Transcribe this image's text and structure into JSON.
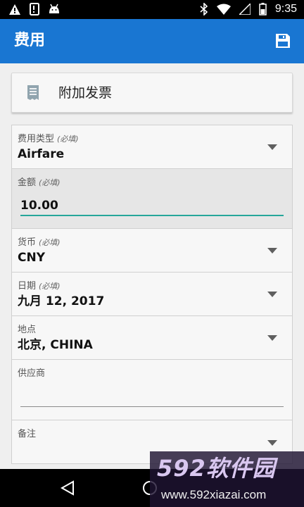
{
  "status_bar": {
    "time": "9:35",
    "left_icons": [
      "warning-icon",
      "sim-card-icon",
      "android-icon"
    ],
    "right_icons": [
      "bluetooth-icon",
      "wifi-icon",
      "signal-icon",
      "battery-icon"
    ]
  },
  "app_bar": {
    "title": "费用",
    "save_icon": "floppy-disk-icon",
    "color": "#1976d2"
  },
  "attach_receipt": {
    "label": "附加发票",
    "icon": "receipt-icon"
  },
  "form": {
    "required_note": "(必填)",
    "expense_type": {
      "label": "费用类型",
      "value": "Airfare"
    },
    "amount": {
      "label": "金额",
      "value": "10.00"
    },
    "currency": {
      "label": "货币",
      "value": "CNY"
    },
    "date": {
      "label": "日期",
      "value": "九月 12, 2017"
    },
    "location": {
      "label": "地点",
      "value": "北京, CHINA"
    },
    "vendor": {
      "label": "供应商",
      "value": ""
    },
    "notes": {
      "label": "备注",
      "value": ""
    },
    "accent": "#26a69a"
  },
  "watermark": {
    "logo": "592软件园",
    "url": "www.592xiazai.com"
  }
}
